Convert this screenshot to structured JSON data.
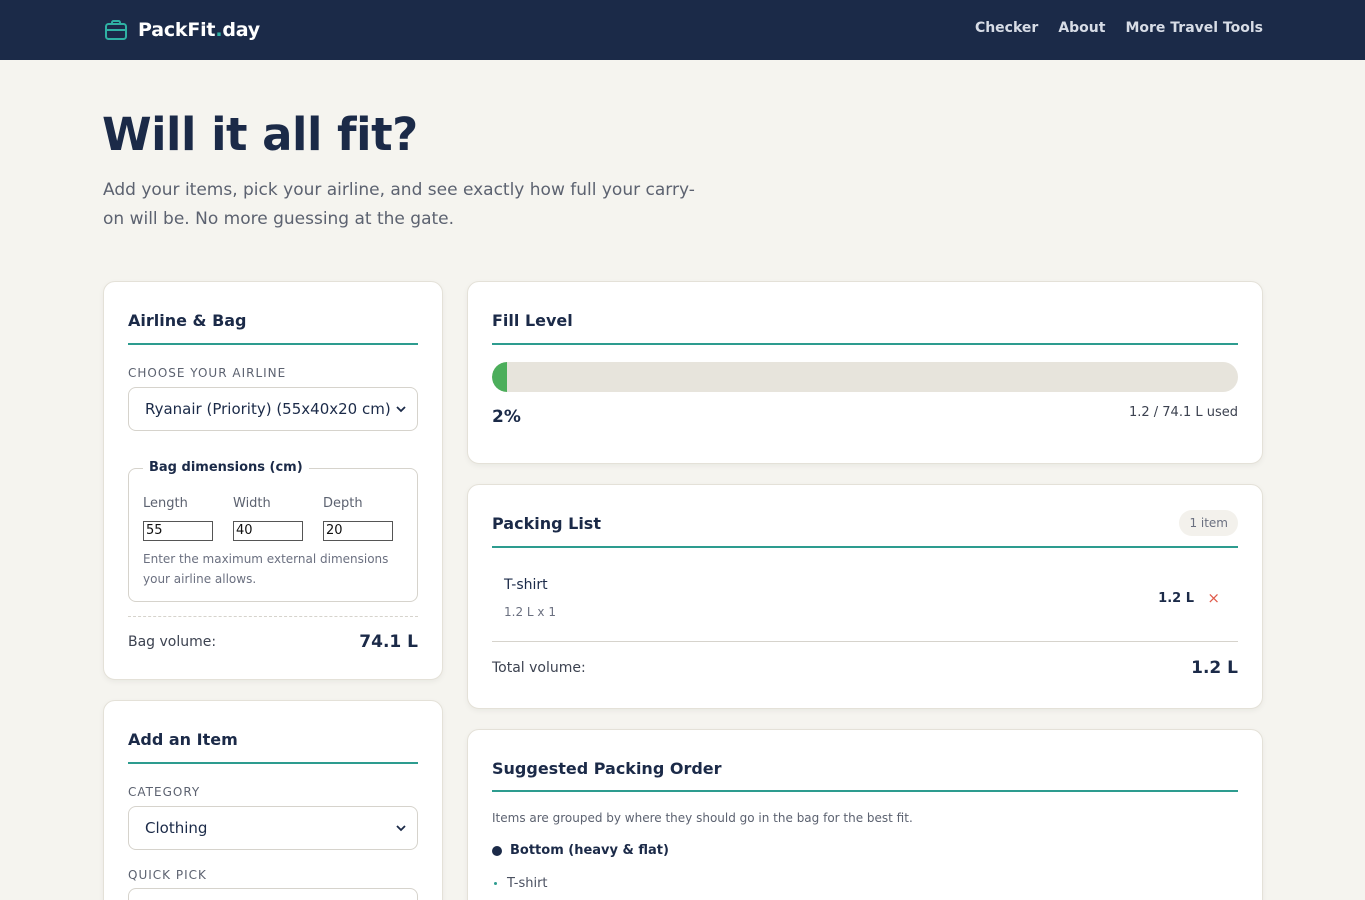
{
  "header": {
    "brand_main": "PackFit",
    "brand_dot": ".",
    "brand_tld": "day",
    "nav": [
      "Checker",
      "About",
      "More Travel Tools"
    ]
  },
  "hero": {
    "title": "Will it all fit?",
    "subtitle": "Add your items, pick your airline, and see exactly how full your carry-on will be. No more guessing at the gate."
  },
  "airline_card": {
    "title": "Airline & Bag",
    "airline_label": "CHOOSE YOUR AIRLINE",
    "airline_selected": "Ryanair (Priority) (55x40x20 cm)",
    "dims_legend": "Bag dimensions (cm)",
    "length_label": "Length",
    "width_label": "Width",
    "depth_label": "Depth",
    "length_value": "55",
    "width_value": "40",
    "depth_value": "20",
    "help_text": "Enter the maximum external dimensions your airline allows.",
    "volume_label": "Bag volume:",
    "volume_value": "74.1 L"
  },
  "add_item_card": {
    "title": "Add an Item",
    "category_label": "CATEGORY",
    "category_selected": "Clothing",
    "quick_pick_label": "QUICK PICK"
  },
  "fill_card": {
    "title": "Fill Level",
    "percent": 2,
    "percent_text": "2%",
    "used_text": "1.2 / 74.1 L used",
    "bar_color": "#4cae5b"
  },
  "packing_card": {
    "title": "Packing List",
    "count_text": "1 item",
    "items": [
      {
        "name": "T-shirt",
        "detail": "1.2 L x 1",
        "volume": "1.2 L",
        "remove": "×"
      }
    ],
    "total_label": "Total volume:",
    "total_value": "1.2 L"
  },
  "suggested_card": {
    "title": "Suggested Packing Order",
    "description": "Items are grouped by where they should go in the bag for the best fit.",
    "groups": [
      {
        "name": "Bottom (heavy & flat)",
        "items": [
          "T-shirt"
        ]
      }
    ]
  },
  "colors": {
    "navy": "#1b2a48",
    "teal": "#2d9c8f",
    "background": "#f5f4ef",
    "remove_red": "#e05a4a"
  },
  "icons": {
    "brand": "suitcase-icon",
    "select": "chevron-down-icon",
    "remove": "close-icon"
  }
}
